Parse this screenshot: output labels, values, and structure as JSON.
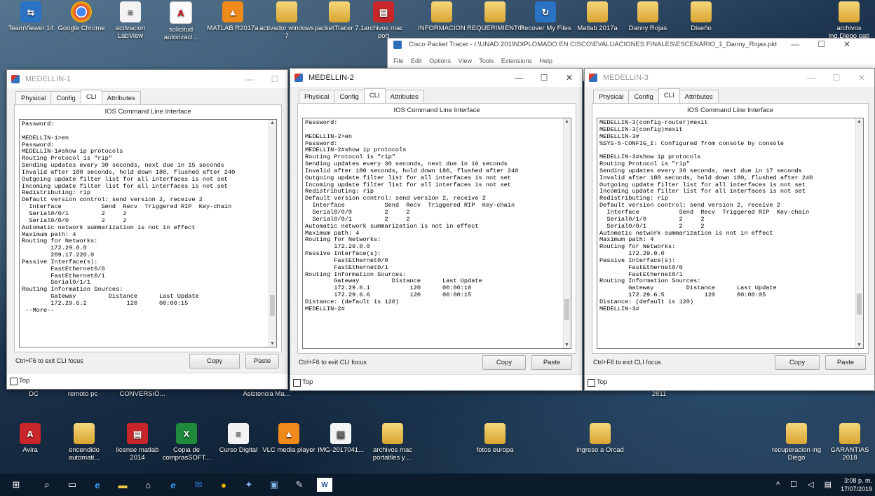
{
  "desktop": {
    "top_icons": [
      {
        "label": "TeamViewer 14",
        "icon": "teamviewer-icon"
      },
      {
        "label": "Google Chrome",
        "icon": "chrome-icon"
      },
      {
        "label": "activacion LabView",
        "icon": "document-icon"
      },
      {
        "label": "solicitud autorizaci...",
        "icon": "pdf-icon"
      },
      {
        "label": "MATLAB R2017a",
        "icon": "matlab-icon"
      },
      {
        "label": "activador windows 7",
        "icon": "folder-icon"
      },
      {
        "label": "packetTracer 7.1",
        "icon": "folder-icon"
      },
      {
        "label": "archivos mac port",
        "icon": "rar-icon"
      },
      {
        "label": "INFORMACION",
        "icon": "folder-icon"
      },
      {
        "label": "REQUERIMIENTO",
        "icon": "folder-icon"
      },
      {
        "label": "Recover My Files",
        "icon": "recover-icon"
      },
      {
        "label": "Matlab 2017a",
        "icon": "folder-icon"
      },
      {
        "label": "Danny Rojas",
        "icon": "folder-icon"
      },
      {
        "label": "Diseño",
        "icon": "folder-icon"
      },
      {
        "label": "archivos ing.Diego pati",
        "icon": "folder-icon"
      }
    ],
    "left_labels": [
      "DC",
      "remoto pc",
      "CONVERSIÓ..."
    ],
    "asistencia_label": "Asistencia Ma...",
    "label_2811": "2811",
    "bottom_icons": [
      {
        "label": "Avira",
        "icon": "avira-icon"
      },
      {
        "label": "encendido automati...",
        "icon": "folder-icon"
      },
      {
        "label": "license matlab 2014",
        "icon": "rar-icon"
      },
      {
        "label": "Copia de comprasSOFT...",
        "icon": "excel-icon"
      },
      {
        "label": "Curso Digital",
        "icon": "document-icon"
      },
      {
        "label": "VLC media player",
        "icon": "vlc-icon"
      },
      {
        "label": "IMG-2017041...",
        "icon": "image-icon"
      },
      {
        "label": "archivos mac portatiles y ...",
        "icon": "folder-icon"
      },
      {
        "label": "fotos europa",
        "icon": "folder-icon"
      },
      {
        "label": "ingreso a Orcad",
        "icon": "folder-icon"
      },
      {
        "label": "recuperacion ing Diego",
        "icon": "folder-icon"
      },
      {
        "label": "GARANTIAS 2018",
        "icon": "folder-icon"
      }
    ]
  },
  "background_window": {
    "title": "Cisco Packet Tracer - I:\\UNAD 2019\\DIPLOMADO EN CISCO\\EVALUACIONES FINALES\\ESCENARIO_1_Danny_Rojas.pkt",
    "menu": [
      "File",
      "Edit",
      "Options",
      "View",
      "Tools",
      "Extensions",
      "Help"
    ]
  },
  "common": {
    "tabs": [
      "Physical",
      "Config",
      "CLI",
      "Attributes"
    ],
    "ios_title": "IOS Command Line Interface",
    "focus_hint": "Ctrl+F6 to exit CLI focus",
    "copy_label": "Copy",
    "paste_label": "Paste",
    "top_label": "Top",
    "window_controls": [
      "—",
      "☐",
      "✕"
    ]
  },
  "windows": [
    {
      "title": "MEDELLIN-1",
      "active": false,
      "cli": "Password:\n\nMEDELLIN-1>en\nPassword:\nMEDELLIN-1#show ip protocols\nRouting Protocol is \"rip\"\nSending updates every 30 seconds, next due in 15 seconds\nInvalid after 180 seconds, hold down 180, flushed after 240\nOutgoing update filter list for all interfaces is not set\nIncoming update filter list for all interfaces is not set\nRedistributing: rip\nDefault version control: send version 2, receive 2\n  Interface           Send  Recv  Triggered RIP  Key-chain\n  Serial0/0/1         2     2\n  Serial0/0/0         2     2\nAutomatic network summarization is not in effect\nMaximum path: 4\nRouting for Networks:\n        172.29.0.0\n        209.17.220.0\nPassive Interface(s):\n        FastEthernet0/0\n        FastEthernet0/1\n        Serial0/1/1\nRouting Information Sources:\n        Gateway         Distance      Last Update\n        172.29.6.2           120      00:00:15\n --More--"
    },
    {
      "title": "MEDELLIN-2",
      "active": true,
      "cli": "Password:\n\nMEDELLIN-2>en\nPassword:\nMEDELLIN-2#show ip protocols\nRouting Protocol is \"rip\"\nSending updates every 30 seconds, next due in 16 seconds\nInvalid after 180 seconds, hold down 180, flushed after 240\nOutgoing update filter list for all interfaces is not set\nIncoming update filter list for all interfaces is not set\nRedistributing: rip\nDefault version control: send version 2, receive 2\n  Interface           Send  Recv  Triggered RIP  Key-chain\n  Serial0/0/0         2     2\n  Serial0/0/1         2     2\nAutomatic network summarization is not in effect\nMaximum path: 4\nRouting for Networks:\n        172.29.0.0\nPassive Interface(s):\n        FastEthernet0/0\n        FastEthernet0/1\nRouting Information Sources:\n        Gateway         Distance      Last Update\n        172.29.6.1           120      00:00:10\n        172.29.6.6           120      00:00:15\nDistance: (default is 120)\nMEDELLIN-2#"
    },
    {
      "title": "MEDELLIN-3",
      "active": false,
      "cli": "MEDELLIN-3(config-router)#exit\nMEDELLIN-3(config)#exit\nMEDELLIN-3#\n%SYS-5-CONFIG_I: Configured from console by console\n\nMEDELLIN-3#show ip protocols\nRouting Protocol is \"rip\"\nSending updates every 30 seconds, next due in 17 seconds\nInvalid after 180 seconds, hold down 180, flushed after 240\nOutgoing update filter list for all interfaces is not set\nIncoming update filter list for all interfaces is not set\nRedistributing: rip\nDefault version control: send version 2, receive 2\n  Interface           Send  Recv  Triggered RIP  Key-chain\n  Serial0/1/0         2     2\n  Serial0/0/1         2     2\nAutomatic network summarization is not in effect\nMaximum path: 4\nRouting for Networks:\n        172.29.0.0\nPassive Interface(s):\n        FastEthernet0/0\n        FastEthernet0/1\nRouting Information Sources:\n        Gateway         Distance      Last Update\n        172.29.6.5           120      00:00:05\nDistance: (default is 120)\nMEDELLIN-3#"
    }
  ],
  "taskbar": {
    "time": "3:08 p. m.",
    "date": "17/07/2019",
    "items": [
      "windows-start-icon",
      "search-icon",
      "task-view-icon",
      "edge-icon",
      "file-explorer-icon",
      "store-icon",
      "ie-icon",
      "outlook-icon",
      "chrome-icon",
      "cisco-icon",
      "photos-icon",
      "paint-icon",
      "word-icon"
    ]
  }
}
